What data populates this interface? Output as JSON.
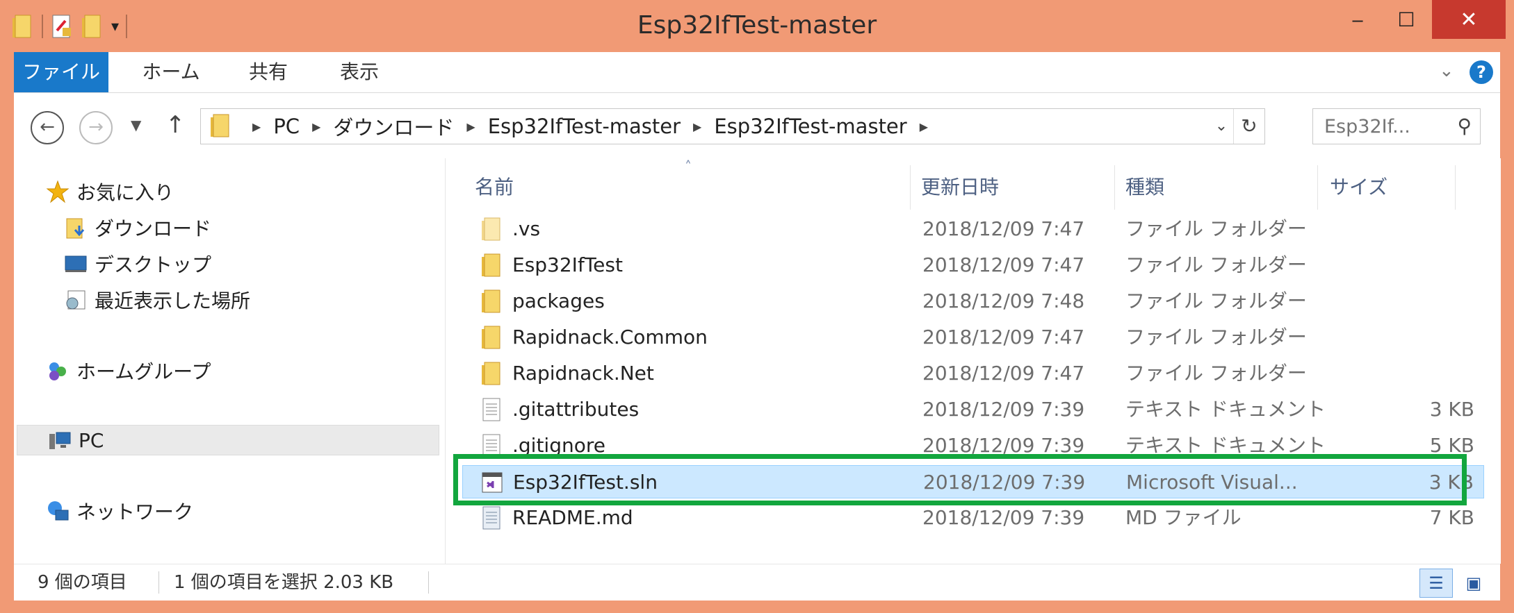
{
  "window": {
    "title": "Esp32IfTest-master",
    "controls": {
      "minimize": "‒",
      "maximize": "☐",
      "close": "✕"
    }
  },
  "ribbon": {
    "tabs": [
      "ファイル",
      "ホーム",
      "共有",
      "表示"
    ],
    "help": "?"
  },
  "address": {
    "crumbs": [
      "PC",
      "ダウンロード",
      "Esp32IfTest-master",
      "Esp32IfTest-master"
    ],
    "search_placeholder": "Esp32If..."
  },
  "nav": {
    "favorites": "お気に入り",
    "downloads": "ダウンロード",
    "desktop": "デスクトップ",
    "recent": "最近表示した場所",
    "homegroup": "ホームグループ",
    "pc": "PC",
    "network": "ネットワーク"
  },
  "columns": {
    "name": "名前",
    "date": "更新日時",
    "type": "種類",
    "size": "サイズ"
  },
  "files": [
    {
      "name": ".vs",
      "date": "2018/12/09 7:47",
      "type": "ファイル フォルダー",
      "size": "",
      "icon": "folder-icon"
    },
    {
      "name": "Esp32IfTest",
      "date": "2018/12/09 7:47",
      "type": "ファイル フォルダー",
      "size": "",
      "icon": "folder-icon"
    },
    {
      "name": "packages",
      "date": "2018/12/09 7:48",
      "type": "ファイル フォルダー",
      "size": "",
      "icon": "folder-icon"
    },
    {
      "name": "Rapidnack.Common",
      "date": "2018/12/09 7:47",
      "type": "ファイル フォルダー",
      "size": "",
      "icon": "folder-icon"
    },
    {
      "name": "Rapidnack.Net",
      "date": "2018/12/09 7:47",
      "type": "ファイル フォルダー",
      "size": "",
      "icon": "folder-icon"
    },
    {
      "name": ".gitattributes",
      "date": "2018/12/09 7:39",
      "type": "テキスト ドキュメント",
      "size": "3 KB",
      "icon": "text-file-icon"
    },
    {
      "name": ".gitignore",
      "date": "2018/12/09 7:39",
      "type": "テキスト ドキュメント",
      "size": "5 KB",
      "icon": "text-file-icon"
    },
    {
      "name": "Esp32IfTest.sln",
      "date": "2018/12/09 7:39",
      "type": "Microsoft Visual...",
      "size": "3 KB",
      "icon": "visual-studio-solution-icon"
    },
    {
      "name": "README.md",
      "date": "2018/12/09 7:39",
      "type": "MD ファイル",
      "size": "7 KB",
      "icon": "markdown-file-icon"
    }
  ],
  "status": {
    "count": "9 個の項目",
    "selection": "1 個の項目を選択  2.03 KB"
  },
  "colors": {
    "frame": "#f19a75",
    "accent": "#1979ca",
    "selected": "#cce8ff",
    "highlight": "#12a63e",
    "close": "#c7392e"
  }
}
